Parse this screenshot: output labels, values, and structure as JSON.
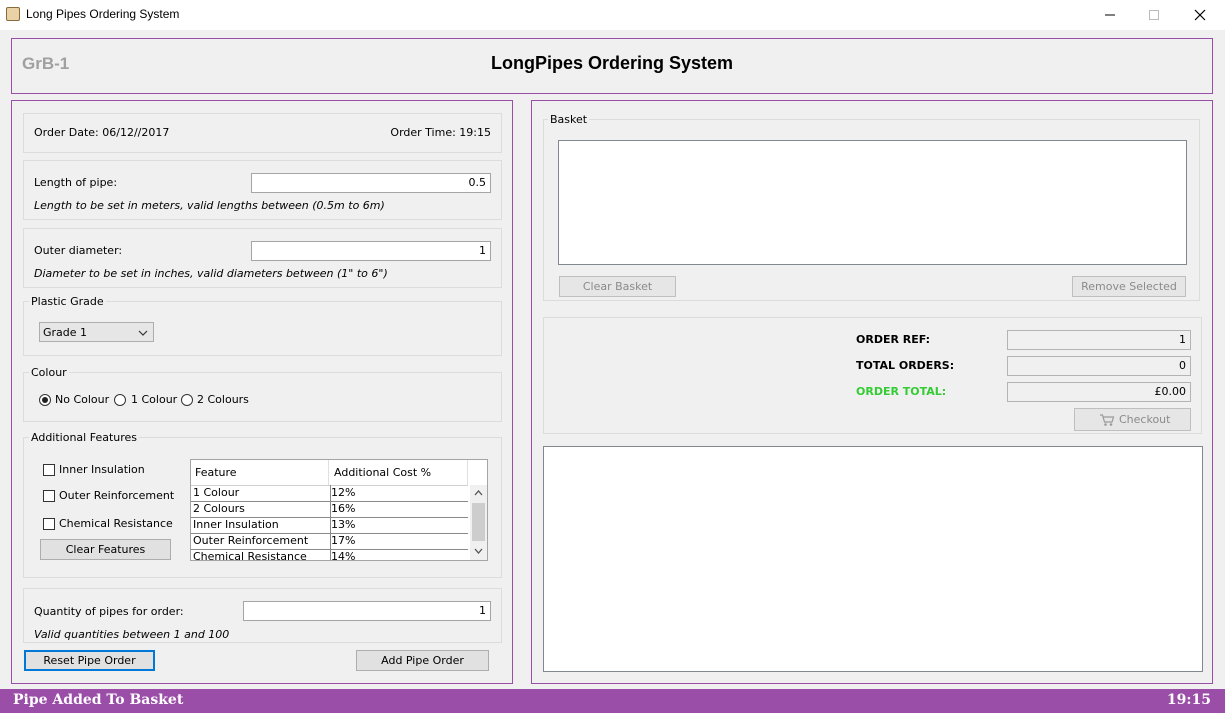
{
  "window": {
    "title": "Long Pipes Ordering System",
    "minimize_icon": "minimize-icon",
    "maximize_icon": "maximize-icon",
    "close_icon": "close-icon"
  },
  "header": {
    "group_id": "GrB-1",
    "title": "LongPipes Ordering System"
  },
  "order": {
    "date_label": "Order Date: 06/12//2017",
    "time_label": "Order Time: 19:15",
    "length_label": "Length of pipe:",
    "length_value": "0.5",
    "length_hint": "Length to be set in meters, valid lengths between (0.5m to 6m)",
    "diameter_label": "Outer diameter:",
    "diameter_value": "1",
    "diameter_hint": "Diameter to be set in inches, valid diameters between  (1\" to 6\")",
    "grade_legend": "Plastic Grade",
    "grade_selected": "Grade 1",
    "colour_legend": "Colour",
    "colour_options": [
      "No Colour",
      "1 Colour",
      "2 Colours"
    ],
    "colour_selected_index": 0,
    "features_legend": "Additional Features",
    "features": [
      "Inner Insulation",
      "Outer Reinforcement",
      "Chemical Resistance"
    ],
    "clear_features_label": "Clear Features",
    "feature_table": {
      "columns": [
        "Feature",
        "Additional Cost %"
      ],
      "rows": [
        [
          "1 Colour",
          "12%"
        ],
        [
          "2 Colours",
          "16%"
        ],
        [
          "Inner Insulation",
          "13%"
        ],
        [
          "Outer Reinforcement",
          "17%"
        ],
        [
          "Chemical Resistance",
          "14%"
        ]
      ]
    },
    "quantity_label": "Quantity of pipes for order:",
    "quantity_value": "1",
    "quantity_hint": "Valid quantities between 1 and 100",
    "reset_label": "Reset Pipe Order",
    "add_label": "Add Pipe Order"
  },
  "basket": {
    "legend": "Basket",
    "items": [],
    "clear_label": "Clear Basket",
    "remove_label": "Remove Selected"
  },
  "summary": {
    "order_ref_label": "ORDER REF:",
    "order_ref_value": "1",
    "total_orders_label": "TOTAL ORDERS:",
    "total_orders_value": "0",
    "order_total_label": "ORDER TOTAL:",
    "order_total_value": "£0.00",
    "order_total_color": "#33cc33",
    "checkout_label": "Checkout",
    "checkout_icon": "cart-icon"
  },
  "status": {
    "message": "Pipe Added To Basket",
    "time": "19:15",
    "color": "#9b4ea8"
  }
}
